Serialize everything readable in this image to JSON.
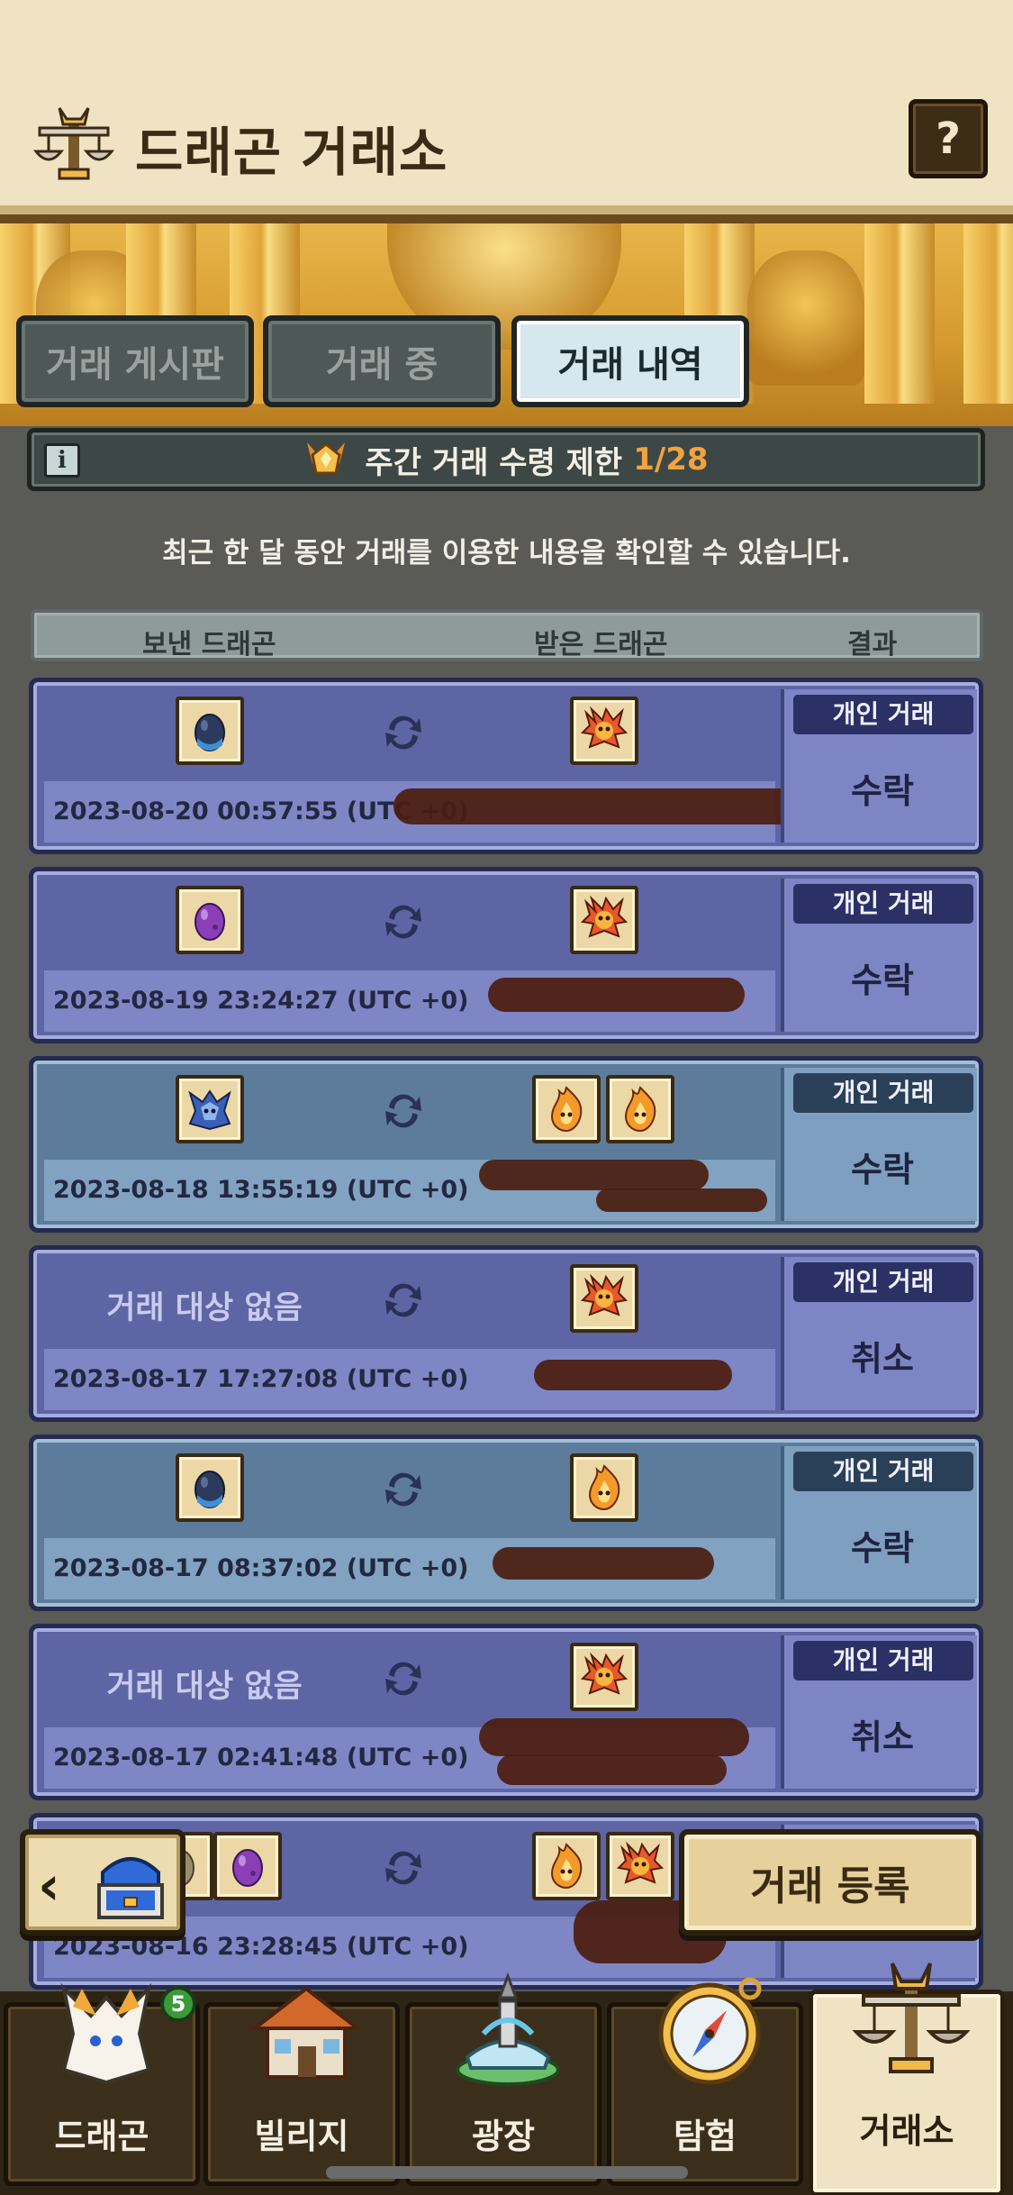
{
  "header": {
    "title": "드래곤 거래소",
    "help_label": "?"
  },
  "tabs": [
    {
      "label": "거래 게시판"
    },
    {
      "label": "거래 중"
    },
    {
      "label": "거래 내역"
    }
  ],
  "limit": {
    "label": "주간 거래 수령 제한",
    "value": "1/28"
  },
  "description": "최근 한 달 동안 거래를 이용한 내용을 확인할 수 있습니다.",
  "columns": {
    "sent": "보낸 드래곤",
    "received": "받은 드래곤",
    "result": "결과"
  },
  "trades": [
    {
      "date": "2023-08-20 00:57:55 (UTC +0)",
      "type": "개인 거래",
      "result": "수락",
      "sent_dragons": [
        "dark-blue-egg"
      ],
      "received_dragons": [
        "fire-dragon"
      ]
    },
    {
      "date": "2023-08-19 23:24:27 (UTC +0)",
      "type": "개인 거래",
      "result": "수락",
      "sent_dragons": [
        "purple-egg"
      ],
      "received_dragons": [
        "fire-dragon"
      ]
    },
    {
      "date": "2023-08-18 13:55:19 (UTC +0)",
      "type": "개인 거래",
      "result": "수락",
      "sent_dragons": [
        "blue-dragon"
      ],
      "received_dragons": [
        "flame-dragon",
        "flame-dragon"
      ]
    },
    {
      "date": "2023-08-17 17:27:08 (UTC +0)",
      "type": "개인 거래",
      "result": "취소",
      "no_target": "거래 대상 없음",
      "received_dragons": [
        "fire-dragon"
      ]
    },
    {
      "date": "2023-08-17 08:37:02 (UTC +0)",
      "type": "개인 거래",
      "result": "수락",
      "sent_dragons": [
        "dark-blue-egg"
      ],
      "received_dragons": [
        "flame-dragon"
      ]
    },
    {
      "date": "2023-08-17 02:41:48 (UTC +0)",
      "type": "개인 거래",
      "result": "취소",
      "no_target": "거래 대상 없음",
      "received_dragons": [
        "fire-dragon"
      ]
    },
    {
      "date": "2023-08-16 23:28:45 (UTC +0)",
      "type": "",
      "result": "",
      "sent_dragons": [
        "egg",
        "purple-egg"
      ],
      "received_dragons": [
        "flame-dragon",
        "fire-dragon"
      ]
    }
  ],
  "buttons": {
    "register": "거래 등록",
    "back": "‹"
  },
  "nav": [
    {
      "label": "드래곤",
      "badge": "5"
    },
    {
      "label": "빌리지"
    },
    {
      "label": "광장"
    },
    {
      "label": "탐험"
    },
    {
      "label": "거래소"
    }
  ],
  "colors": {
    "accent": "#f0a340",
    "row_purple": "#5e65a4",
    "row_blue": "#5d7c9c",
    "header_bg": "#efe3c4"
  }
}
